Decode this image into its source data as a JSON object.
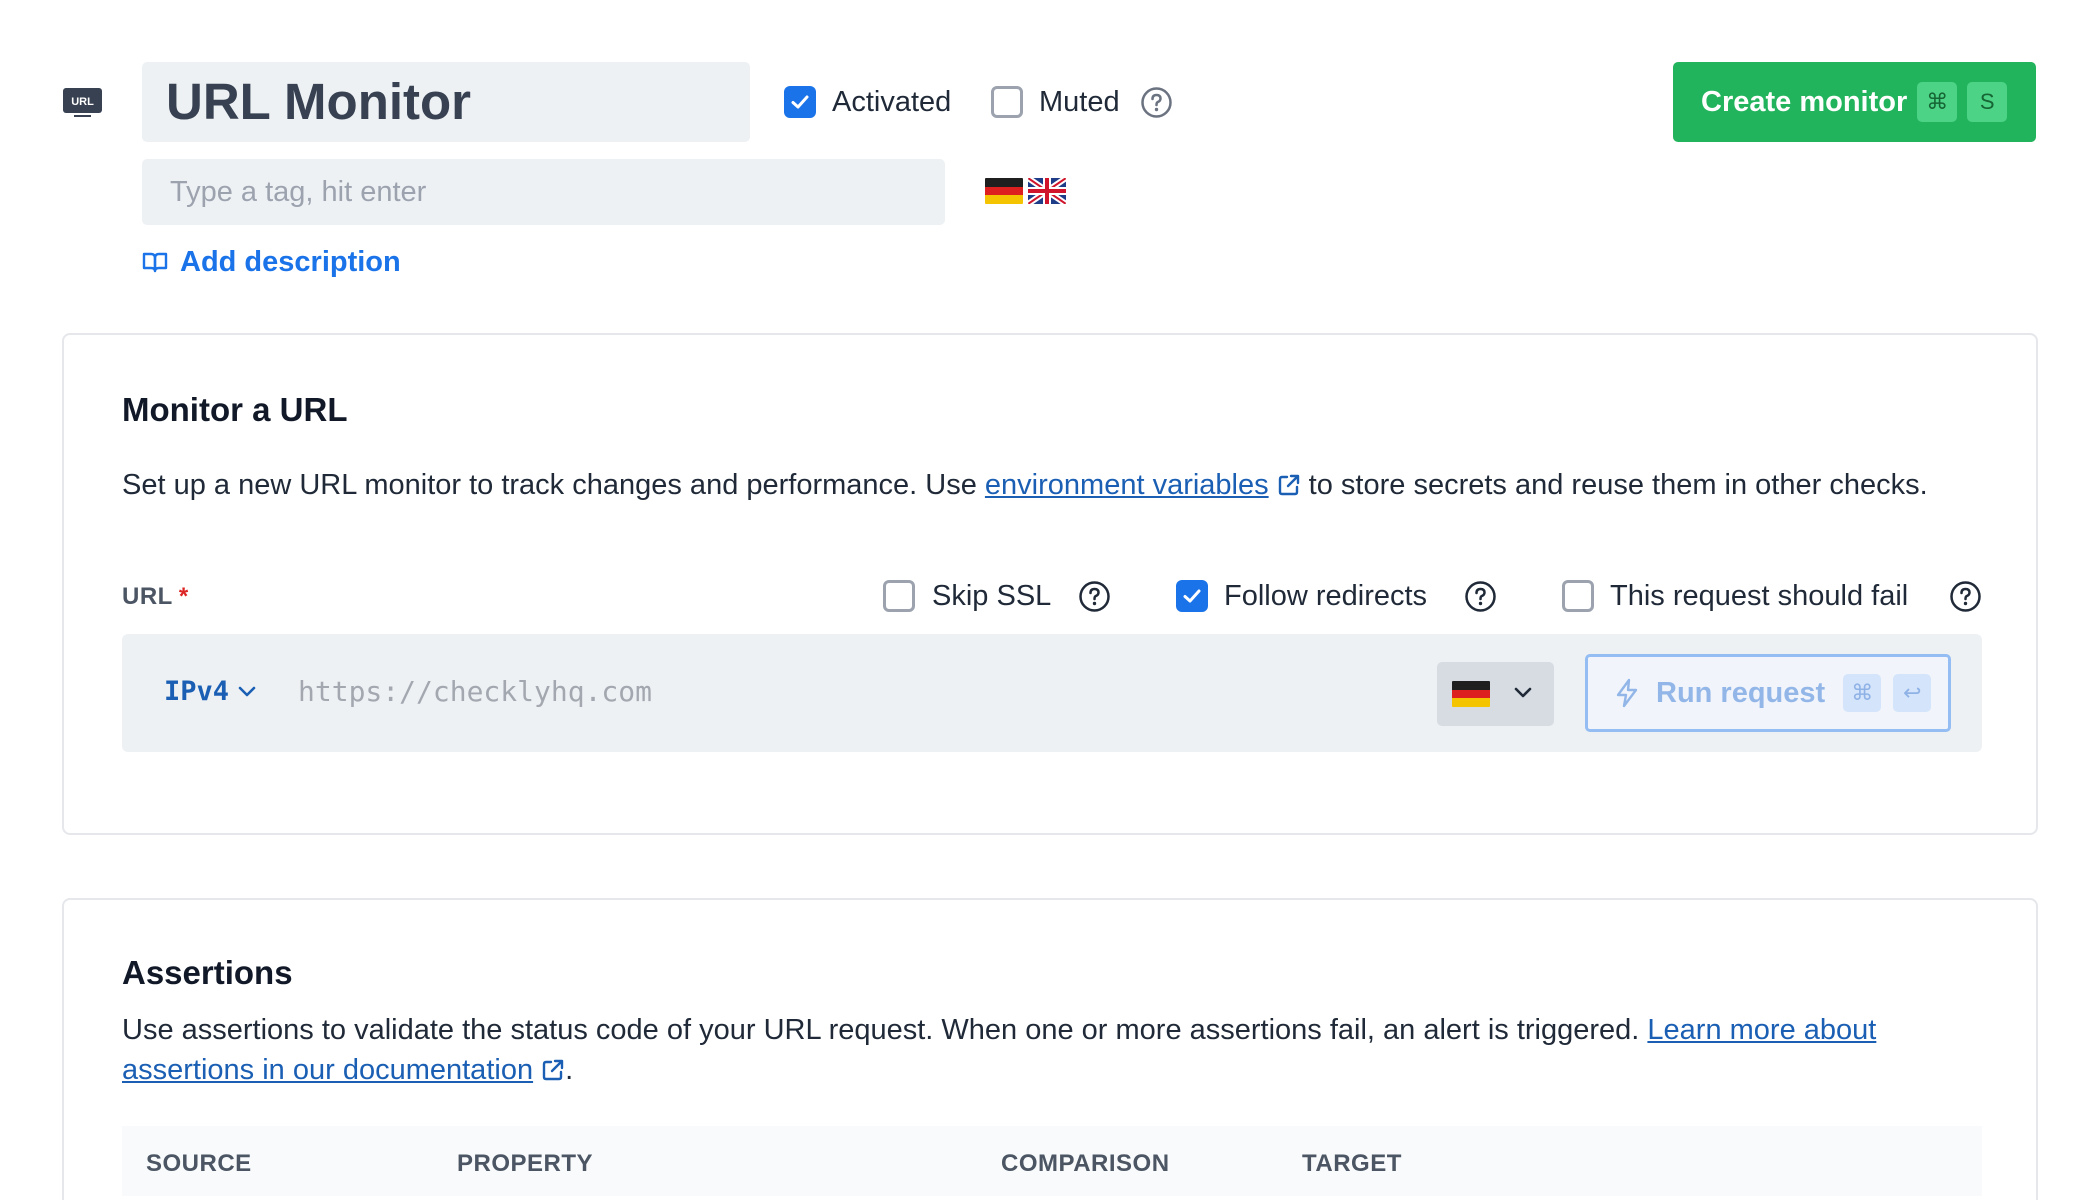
{
  "header": {
    "type_badge": "URL",
    "title": "URL Monitor",
    "activated_label": "Activated",
    "activated_checked": true,
    "muted_label": "Muted",
    "muted_checked": false,
    "create_label": "Create monitor",
    "create_shortcut": [
      "⌘",
      "S"
    ],
    "tag_placeholder": "Type a tag, hit enter",
    "flags": [
      "German flag",
      "UK flag"
    ],
    "add_description": "Add description"
  },
  "monitor_card": {
    "title": "Monitor a URL",
    "desc_before": "Set up a new URL monitor to track changes and performance. Use ",
    "desc_link": "environment variables",
    "desc_after": " to store secrets and reuse them in other checks.",
    "url_label": "URL",
    "required_mark": "*",
    "options": [
      {
        "label": "Skip SSL",
        "checked": false
      },
      {
        "label": "Follow redirects",
        "checked": true
      },
      {
        "label": "This request should fail",
        "checked": false
      }
    ],
    "ip_version": "IPv4",
    "url_placeholder": "https://checklyhq.com",
    "location_flag": "German flag",
    "run_label": "Run request",
    "run_shortcut": [
      "⌘",
      "↩"
    ]
  },
  "assertions_card": {
    "title": "Assertions",
    "desc_before": "Use assertions to validate the status code of your URL request. When one or more assertions fail, an alert is triggered. ",
    "desc_link": "Learn more about assertions in our documentation",
    "desc_after": ".",
    "columns": [
      "SOURCE",
      "PROPERTY",
      "COMPARISON",
      "TARGET"
    ]
  },
  "colors": {
    "primary_blue": "#1a73e8",
    "link_blue": "#1a5fb4",
    "create_green": "#22b45c",
    "required_red": "#dc2626"
  }
}
